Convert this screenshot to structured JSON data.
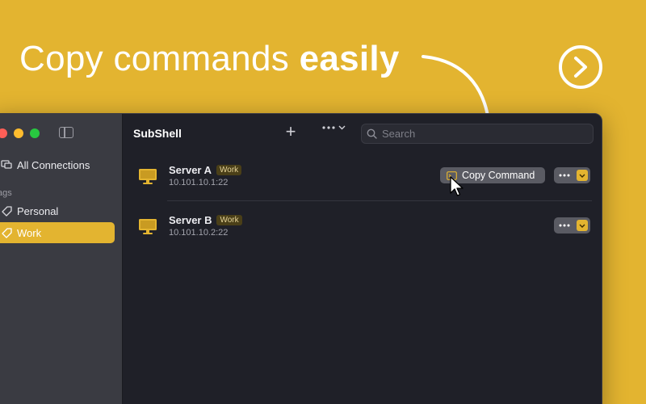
{
  "headline": {
    "text_regular": "Copy commands",
    "text_bold": "easily"
  },
  "next_button_label": "",
  "window": {
    "app_title": "SubShell",
    "search_placeholder": "Search",
    "sidebar": {
      "all_connections": "All Connections",
      "tags_section": "ags",
      "items": [
        {
          "label": "Personal"
        },
        {
          "label": "Work"
        }
      ]
    },
    "servers": [
      {
        "name": "Server A",
        "tag": "Work",
        "address": "10.101.10.1:22",
        "copy_label": "Copy Command"
      },
      {
        "name": "Server B",
        "tag": "Work",
        "address": "10.101.10.2:22"
      }
    ]
  },
  "colors": {
    "accent": "#e3b430",
    "window_bg": "#1f2028",
    "sidebar_bg": "#3a3b42"
  },
  "icons": [
    "chevron-right-circle-icon",
    "sidebar-toggle-icon",
    "connections-icon",
    "tag-icon",
    "plus-icon",
    "ellipsis-icon",
    "chevron-down-icon",
    "search-icon",
    "monitor-icon",
    "terminal-icon",
    "cursor-icon"
  ]
}
